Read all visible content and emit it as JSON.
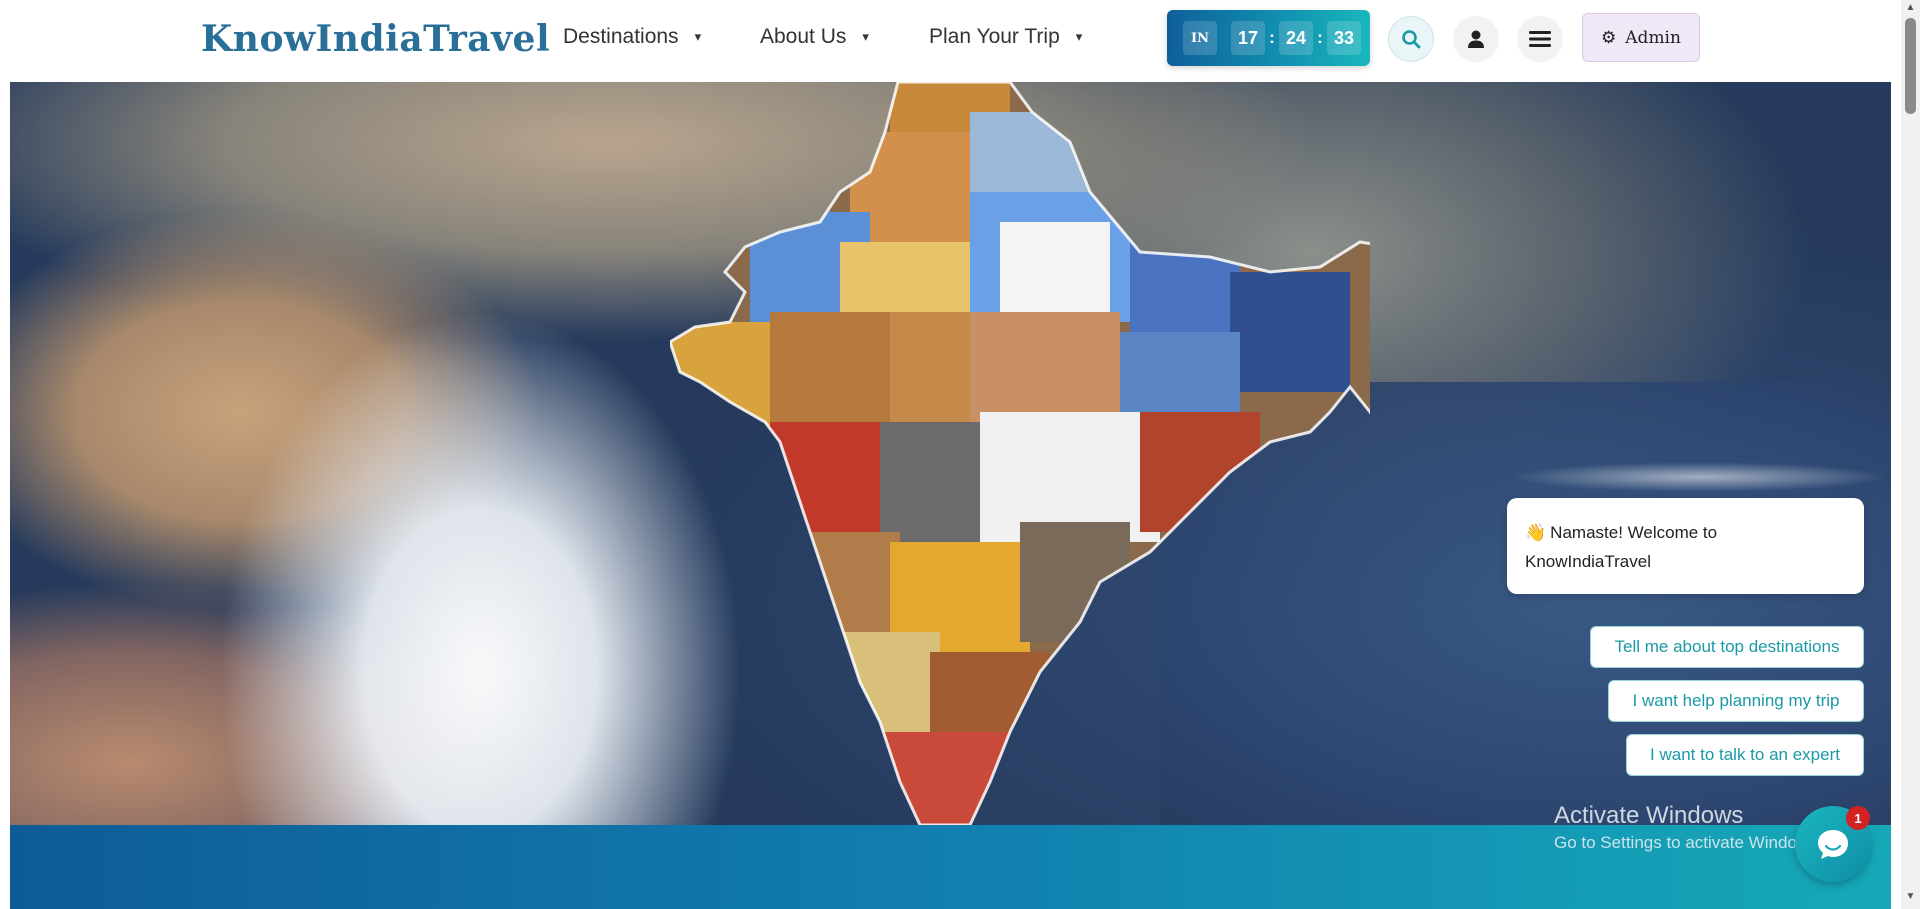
{
  "header": {
    "logo": "KnowIndiaTravel",
    "nav": [
      {
        "label": "Destinations"
      },
      {
        "label": "About Us"
      },
      {
        "label": "Plan Your Trip"
      }
    ],
    "caret": "▾",
    "clock": {
      "country": "IN",
      "hours": "17",
      "minutes": "24",
      "seconds": "33",
      "separator": ":"
    },
    "admin_label": "Admin",
    "icons": [
      "search-icon",
      "user-icon",
      "hamburger-menu-icon",
      "gear-icon"
    ]
  },
  "hero": {
    "description_colors": {
      "ocean": "#2b4268",
      "cloud": "#f2f4f8",
      "land": "#b9a58e"
    }
  },
  "chat": {
    "greeting_emoji": "👋",
    "greeting": "Namaste! Welcome to KnowIndiaTravel",
    "quick_replies": [
      "Tell me about top destinations",
      "I want help planning my trip",
      "I want to talk to an expert"
    ],
    "unread_count": "1"
  },
  "watermark": {
    "title": "Activate Windows",
    "subtitle": "Go to Settings to activate Windows."
  },
  "colors": {
    "brand": "#2a6f97",
    "accent": "#1a9aa6",
    "band_start": "#0e5c96",
    "band_end": "#16a9b8",
    "badge": "#d32222"
  }
}
